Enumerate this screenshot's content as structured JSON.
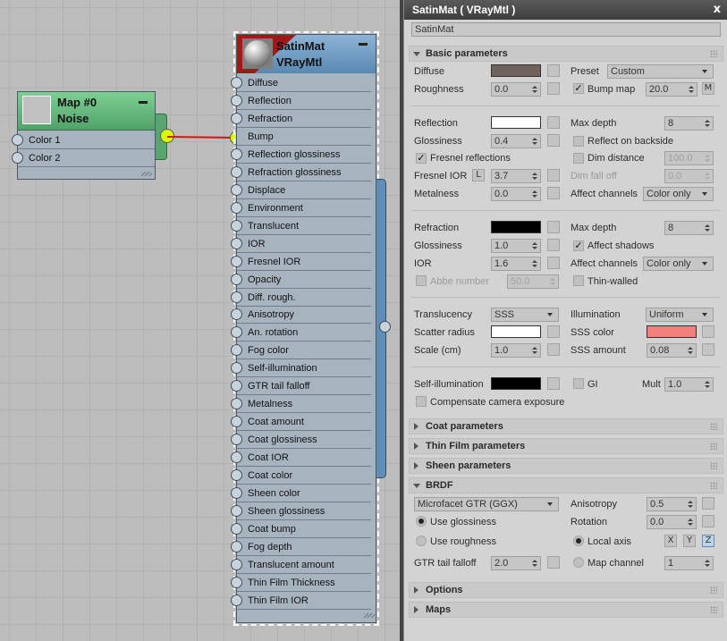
{
  "noise_node": {
    "title_line1": "Map #0",
    "title_line2": "Noise",
    "inputs": [
      "Color 1",
      "Color 2"
    ]
  },
  "vray_node": {
    "title_line1": "SatinMat",
    "title_line2": "VRayMtl",
    "inputs": [
      "Diffuse",
      "Reflection",
      "Refraction",
      "Bump",
      "Reflection glossiness",
      "Refraction glossiness",
      "Displace",
      "Environment",
      "Translucent",
      "IOR",
      "Fresnel IOR",
      "Opacity",
      "Diff. rough.",
      "Anisotropy",
      "An. rotation",
      "Fog color",
      "Self-illumination",
      "GTR tail falloff",
      "Metalness",
      "Coat amount",
      "Coat glossiness",
      "Coat IOR",
      "Coat color",
      "Sheen color",
      "Sheen glossiness",
      "Coat bump",
      "Fog depth",
      "Translucent amount",
      "Thin Film Thickness",
      "Thin Film IOR"
    ],
    "connected_input": "Bump"
  },
  "panel": {
    "title": "SatinMat  ( VRayMtl )",
    "close_label": "x",
    "material_name": "SatinMat",
    "basic": {
      "rollout_label": "Basic parameters",
      "diffuse_label": "Diffuse",
      "diffuse_color": "#6f635c",
      "preset_label": "Preset",
      "preset_value": "Custom",
      "roughness_label": "Roughness",
      "roughness_value": "0.0",
      "bump_label": "Bump map",
      "bump_value": "20.0",
      "bump_map_btn": "M",
      "reflection_label": "Reflection",
      "reflection_color": "#ffffff",
      "refl_maxdepth_label": "Max depth",
      "refl_maxdepth_value": "8",
      "refl_gloss_label": "Glossiness",
      "refl_gloss_value": "0.4",
      "reflect_backside_label": "Reflect on backside",
      "fresnel_label": "Fresnel reflections",
      "dim_distance_label": "Dim distance",
      "dim_distance_value": "100.0",
      "fresnel_ior_label": "Fresnel IOR",
      "fresnel_lock": "L",
      "fresnel_ior_value": "3.7",
      "dim_falloff_label": "Dim fall off",
      "dim_falloff_value": "0.0",
      "metalness_label": "Metalness",
      "metalness_value": "0.0",
      "refl_affect_label": "Affect channels",
      "refl_affect_value": "Color only",
      "refraction_label": "Refraction",
      "refraction_color": "#000000",
      "refr_maxdepth_label": "Max depth",
      "refr_maxdepth_value": "8",
      "refr_gloss_label": "Glossiness",
      "refr_gloss_value": "1.0",
      "affect_shadows_label": "Affect shadows",
      "ior_label": "IOR",
      "ior_value": "1.6",
      "refr_affect_label": "Affect channels",
      "refr_affect_value": "Color only",
      "abbe_label": "Abbe number",
      "abbe_value": "50.0",
      "thin_walled_label": "Thin-walled",
      "translucency_label": "Translucency",
      "translucency_value": "SSS",
      "illumination_label": "Illumination",
      "illumination_value": "Uniform",
      "scatter_label": "Scatter radius",
      "scatter_color": "#ffffff",
      "sss_color_label": "SSS color",
      "sss_color": "#f47f7f",
      "scale_label": "Scale (cm)",
      "scale_value": "1.0",
      "sss_amount_label": "SSS amount",
      "sss_amount_value": "0.08",
      "selfillum_label": "Self-illumination",
      "selfillum_color": "#000000",
      "gi_label": "GI",
      "mult_label": "Mult",
      "mult_value": "1.0",
      "compensate_label": "Compensate camera exposure"
    },
    "collapsed_rollouts": [
      "Coat parameters",
      "Thin Film parameters",
      "Sheen parameters"
    ],
    "brdf": {
      "rollout_label": "BRDF",
      "type_value": "Microfacet GTR (GGX)",
      "anisotropy_label": "Anisotropy",
      "anisotropy_value": "0.5",
      "use_glossiness_label": "Use glossiness",
      "rotation_label": "Rotation",
      "rotation_value": "0.0",
      "use_roughness_label": "Use roughness",
      "local_axis_label": "Local axis",
      "axis_x": "X",
      "axis_y": "Y",
      "axis_z": "Z",
      "gtr_label": "GTR tail falloff",
      "gtr_value": "2.0",
      "map_channel_label": "Map channel",
      "map_channel_value": "1"
    },
    "bottom_rollouts": [
      "Options",
      "Maps"
    ]
  }
}
